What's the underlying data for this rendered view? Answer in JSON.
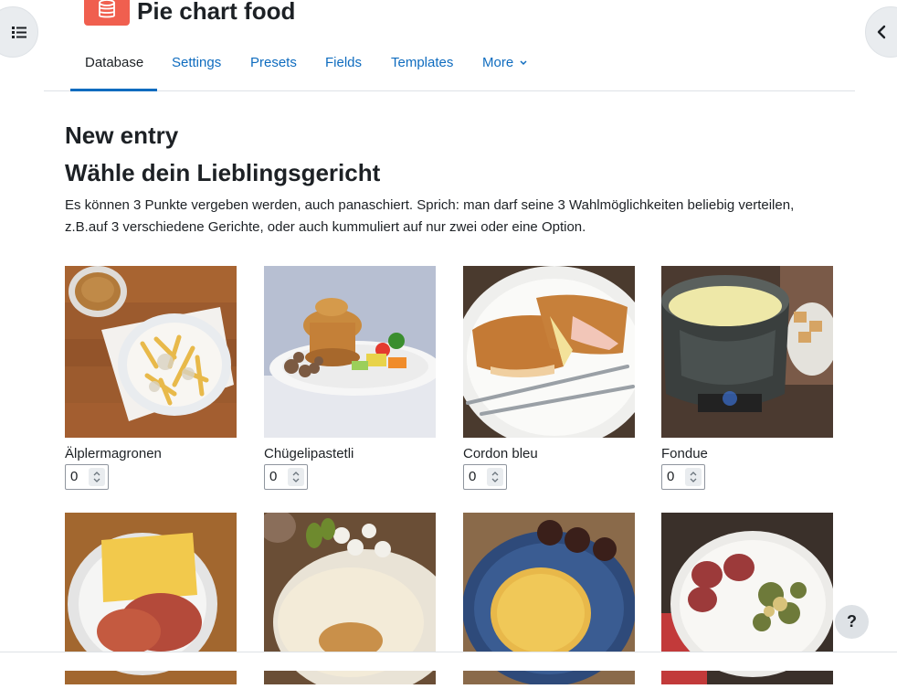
{
  "header": {
    "title": "Pie chart food",
    "icon": "database-icon"
  },
  "tabs": [
    {
      "label": "Database",
      "active": true
    },
    {
      "label": "Settings"
    },
    {
      "label": "Presets"
    },
    {
      "label": "Fields"
    },
    {
      "label": "Templates"
    },
    {
      "label": "More"
    }
  ],
  "main": {
    "heading": "New entry",
    "subheading": "Wähle dein Lieblingsgericht",
    "description": "Es können 3 Punkte vergeben werden, auch panaschiert. Sprich: man darf seine 3 Wahlmöglichkeiten beliebig verteilen, z.B.auf 3 verschiedene Gerichte, oder auch kummuliert auf nur zwei oder eine Option."
  },
  "dishes": [
    {
      "name": "Älplermagronen",
      "value": "0"
    },
    {
      "name": "Chügelipastetli",
      "value": "0"
    },
    {
      "name": "Cordon bleu",
      "value": "0"
    },
    {
      "name": "Fondue",
      "value": "0"
    }
  ],
  "help": {
    "label": "?"
  },
  "colors": {
    "accent": "#0f6cbf",
    "header_icon": "#f05f4f",
    "text": "#1d2125"
  }
}
